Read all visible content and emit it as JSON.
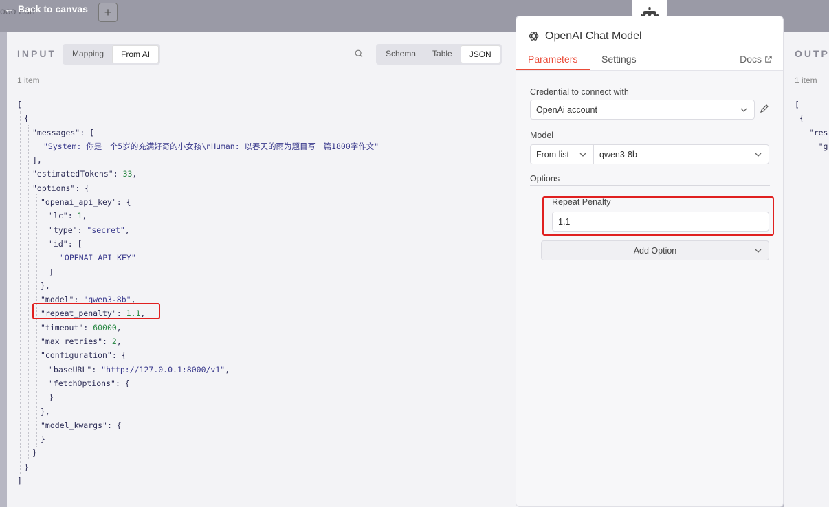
{
  "canvas": {
    "back_label": "Back to canvas",
    "plus_label": "+",
    "ghost_node_label": "ooo n8n"
  },
  "input_panel": {
    "label": "INPUT",
    "mapping_options": [
      "Mapping",
      "From AI"
    ],
    "mapping_active": "From AI",
    "view_options": [
      "Schema",
      "Table",
      "JSON"
    ],
    "view_active": "JSON",
    "item_count": "1 item",
    "json_lines": [
      {
        "indent": 0,
        "parts": [
          [
            "p",
            "["
          ]
        ]
      },
      {
        "indent": 1,
        "parts": [
          [
            "p",
            "{"
          ]
        ]
      },
      {
        "indent": 2,
        "parts": [
          [
            "k",
            "\"messages\""
          ],
          [
            "p",
            ": ["
          ]
        ]
      },
      {
        "indent": 3,
        "parts": [
          [
            "s",
            "\"System: 你是一个5岁的充满好奇的小女孩\\nHuman: 以春天的雨为题目写一篇1800字作文\""
          ]
        ]
      },
      {
        "indent": 2,
        "parts": [
          [
            "p",
            "],"
          ]
        ]
      },
      {
        "indent": 2,
        "parts": [
          [
            "k",
            "\"estimatedTokens\""
          ],
          [
            "p",
            ": "
          ],
          [
            "n",
            "33"
          ],
          [
            "p",
            ","
          ]
        ]
      },
      {
        "indent": 2,
        "parts": [
          [
            "k",
            "\"options\""
          ],
          [
            "p",
            ": {"
          ]
        ]
      },
      {
        "indent": 3,
        "parts": [
          [
            "k",
            "\"openai_api_key\""
          ],
          [
            "p",
            ": {"
          ]
        ]
      },
      {
        "indent": 4,
        "parts": [
          [
            "k",
            "\"lc\""
          ],
          [
            "p",
            ": "
          ],
          [
            "n",
            "1"
          ],
          [
            "p",
            ","
          ]
        ]
      },
      {
        "indent": 4,
        "parts": [
          [
            "k",
            "\"type\""
          ],
          [
            "p",
            ": "
          ],
          [
            "s",
            "\"secret\""
          ],
          [
            "p",
            ","
          ]
        ]
      },
      {
        "indent": 4,
        "parts": [
          [
            "k",
            "\"id\""
          ],
          [
            "p",
            ": ["
          ]
        ]
      },
      {
        "indent": 5,
        "parts": [
          [
            "s",
            "\"OPENAI_API_KEY\""
          ]
        ]
      },
      {
        "indent": 4,
        "parts": [
          [
            "p",
            "]"
          ]
        ]
      },
      {
        "indent": 3,
        "parts": [
          [
            "p",
            "},"
          ]
        ]
      },
      {
        "indent": 3,
        "parts": [
          [
            "k",
            "\"model\""
          ],
          [
            "p",
            ": "
          ],
          [
            "s",
            "\"qwen3-8b\""
          ],
          [
            "p",
            ","
          ]
        ]
      },
      {
        "indent": 3,
        "parts": [
          [
            "k",
            "\"repeat_penalty\""
          ],
          [
            "p",
            ": "
          ],
          [
            "n",
            "1.1"
          ],
          [
            "p",
            ","
          ]
        ]
      },
      {
        "indent": 3,
        "parts": [
          [
            "k",
            "\"timeout\""
          ],
          [
            "p",
            ": "
          ],
          [
            "n",
            "60000"
          ],
          [
            "p",
            ","
          ]
        ]
      },
      {
        "indent": 3,
        "parts": [
          [
            "k",
            "\"max_retries\""
          ],
          [
            "p",
            ": "
          ],
          [
            "n",
            "2"
          ],
          [
            "p",
            ","
          ]
        ]
      },
      {
        "indent": 3,
        "parts": [
          [
            "k",
            "\"configuration\""
          ],
          [
            "p",
            ": {"
          ]
        ]
      },
      {
        "indent": 4,
        "parts": [
          [
            "k",
            "\"baseURL\""
          ],
          [
            "p",
            ": "
          ],
          [
            "s",
            "\"http://127.0.0.1:8000/v1\""
          ],
          [
            "p",
            ","
          ]
        ]
      },
      {
        "indent": 4,
        "parts": [
          [
            "k",
            "\"fetchOptions\""
          ],
          [
            "p",
            ": {"
          ]
        ]
      },
      {
        "indent": 4,
        "parts": [
          [
            "p",
            "}"
          ]
        ]
      },
      {
        "indent": 3,
        "parts": [
          [
            "p",
            "},"
          ]
        ]
      },
      {
        "indent": 3,
        "parts": [
          [
            "k",
            "\"model_kwargs\""
          ],
          [
            "p",
            ": {"
          ]
        ]
      },
      {
        "indent": 3,
        "parts": [
          [
            "p",
            "}"
          ]
        ]
      },
      {
        "indent": 2,
        "parts": [
          [
            "p",
            "}"
          ]
        ]
      },
      {
        "indent": 1,
        "parts": [
          [
            "p",
            "}"
          ]
        ]
      },
      {
        "indent": 0,
        "parts": [
          [
            "p",
            "]"
          ]
        ]
      }
    ]
  },
  "node_panel": {
    "title": "OpenAI Chat Model",
    "tabs": [
      "Parameters",
      "Settings"
    ],
    "active_tab": "Parameters",
    "docs_label": "Docs",
    "credential_label": "Credential to connect with",
    "credential_value": "OpenAi account",
    "model_label": "Model",
    "model_mode": "From list",
    "model_value": "qwen3-8b",
    "options_label": "Options",
    "repeat_penalty_label": "Repeat Penalty",
    "repeat_penalty_value": "1.1",
    "add_option_label": "Add Option"
  },
  "output_panel": {
    "label": "OUTPU",
    "item_count": "1 item",
    "json_preview": "[\n {\n   \"res\n     \"g"
  },
  "colors": {
    "accent": "#ea4b38",
    "highlight": "#e02020",
    "number": "#2e8a48",
    "string": "#3a3a8c"
  }
}
